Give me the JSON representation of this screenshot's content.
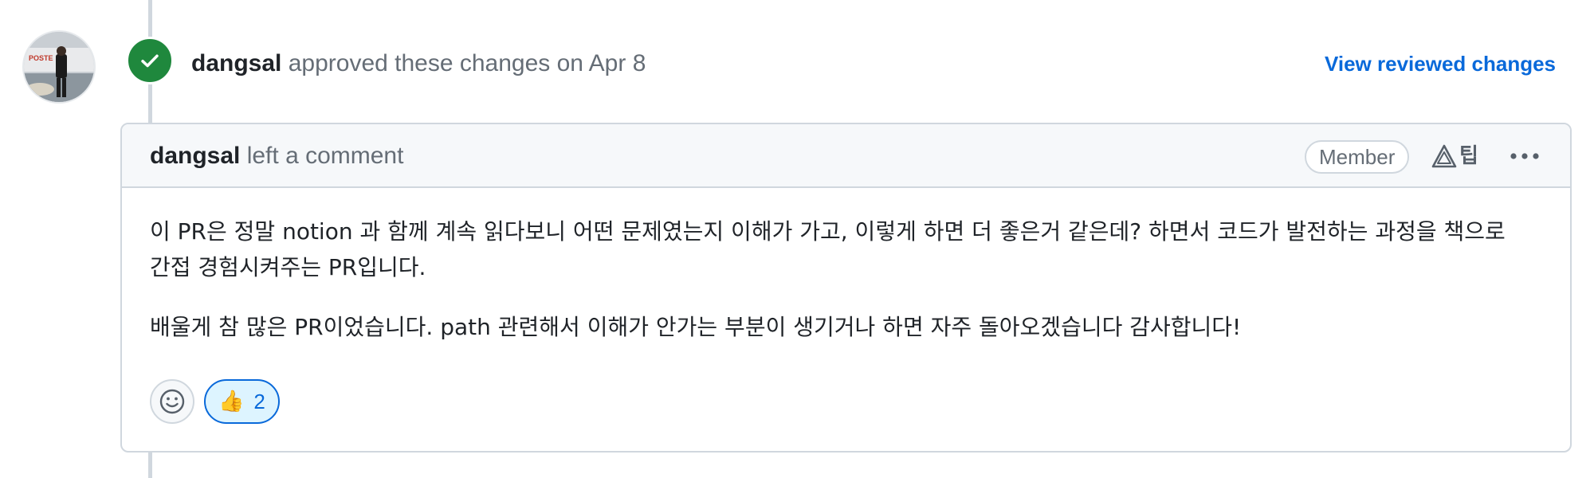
{
  "review": {
    "author": "dangsal",
    "action_text": " approved these changes on Apr 8",
    "view_changes_label": "View reviewed changes"
  },
  "comment": {
    "author": "dangsal",
    "action_text": " left a comment",
    "member_badge": "Member",
    "report_label": "팁",
    "paragraphs": [
      "이 PR은 정말 notion 과 함께 계속 읽다보니 어떤 문제였는지 이해가 가고, 이렇게 하면 더 좋은거 같은데? 하면서 코드가 발전하는 과정을 책으로 간접 경험시켜주는 PR입니다.",
      "배울게 참 많은 PR이었습니다. path 관련해서 이해가 안가는 부분이 생기거나 하면 자주 돌아오겠습니다 감사합니다!"
    ]
  },
  "reactions": [
    {
      "icon": "thumbs-up-icon",
      "emoji": "👍",
      "count": "2"
    }
  ],
  "colors": {
    "approved_green": "#1f883d",
    "link_blue": "#0969da",
    "muted_text": "#656d76",
    "border": "#d0d7de"
  }
}
